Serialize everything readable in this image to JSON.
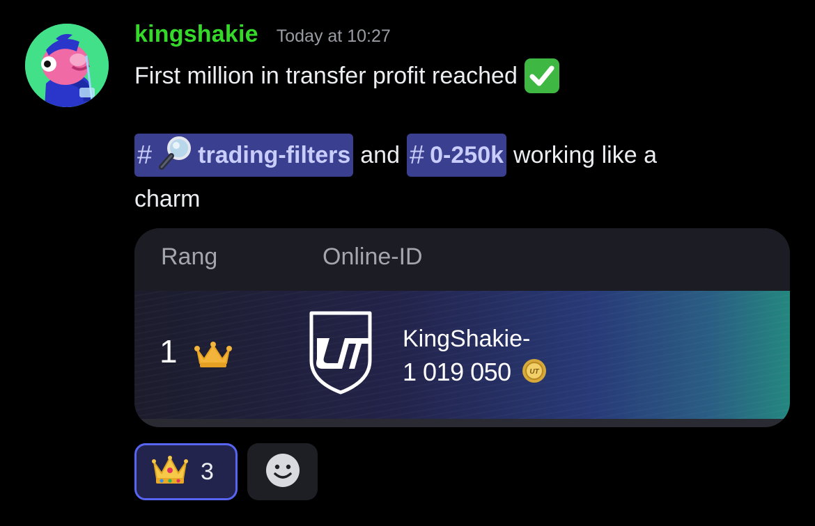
{
  "message": {
    "username": "kingshakie",
    "timestamp": "Today at 10:27",
    "line1": "First million in transfer profit reached",
    "line1_emoji": "check-mark-button",
    "mention1": {
      "hash": "#",
      "label": "trading-filters",
      "icon": "magnifier-icon"
    },
    "connector": "and",
    "mention2": {
      "hash": "#",
      "label": "0-250k"
    },
    "trailing": "working like a",
    "line3": "charm"
  },
  "card": {
    "headers": {
      "rank": "Rang",
      "online_id": "Online-ID"
    },
    "row": {
      "rank": "1",
      "player_name": "KingShakie-",
      "value": "1 019 050",
      "icons": [
        "crown-icon",
        "ut-badge-icon",
        "coin-icon"
      ]
    }
  },
  "reactions": [
    {
      "emoji": "crown",
      "count": "3",
      "selected": true
    }
  ],
  "colors": {
    "username": "#35d92a",
    "mention_bg": "#3b3f8f",
    "mention_text": "#c9cdfb",
    "reaction_border": "#5865f2"
  }
}
